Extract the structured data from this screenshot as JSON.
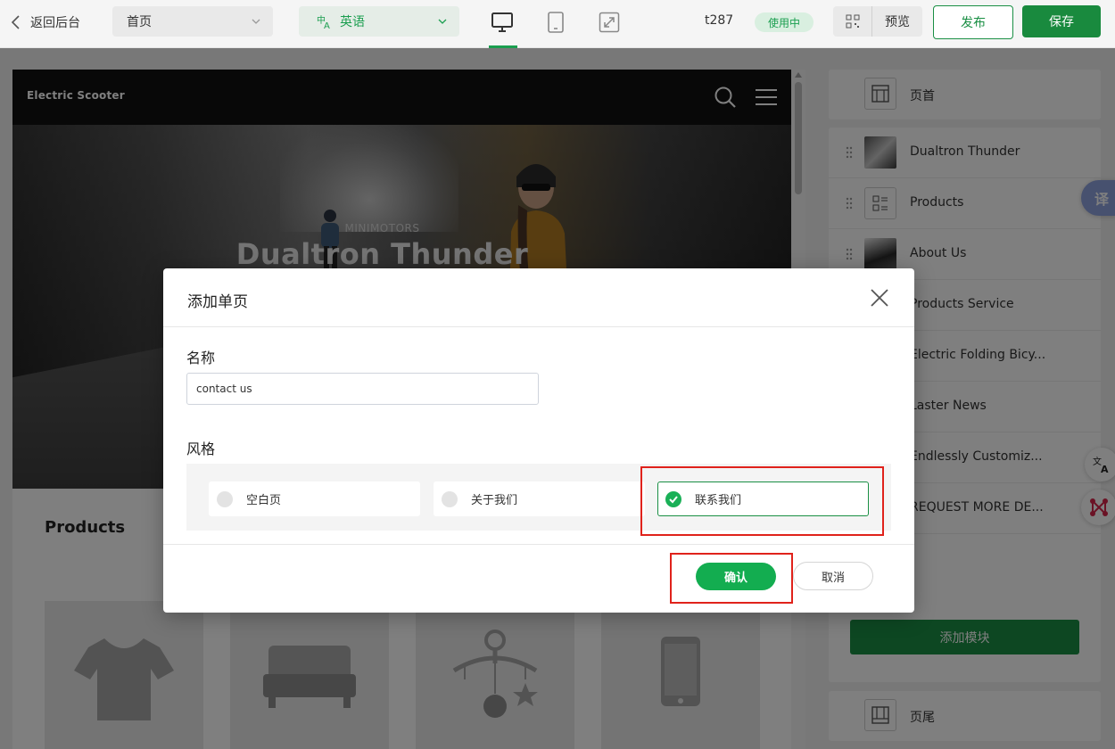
{
  "toolbar": {
    "back_label": "返回后台",
    "page_select": "首页",
    "lang_select": "英语",
    "site_id": "t287",
    "status": "使用中",
    "preview_label": "预览",
    "publish_label": "发布",
    "save_label": "保存"
  },
  "canvas": {
    "logo": "Electric Scooter",
    "hero_subtitle": "MINIMOTORS",
    "hero_title": "Dualtron Thunder",
    "products_title": "Products",
    "product_icons": [
      "tshirt-icon",
      "sofa-icon",
      "baby-mobile-icon",
      "phone-icon"
    ]
  },
  "panel": {
    "header_module": "页首",
    "modules": [
      {
        "label": "Dualtron Thunder",
        "icon": "photo-thumb"
      },
      {
        "label": "Products",
        "icon": "list-icon"
      },
      {
        "label": "About Us",
        "icon": "photo-thumb"
      },
      {
        "label": "Products Service",
        "icon": "photo-thumb"
      },
      {
        "label": "Electric Folding Bicy...",
        "icon": "photo-thumb"
      },
      {
        "label": "Laster News",
        "icon": "photo-thumb"
      },
      {
        "label": "Endlessly Customiz...",
        "icon": "photo-thumb"
      },
      {
        "label": "REQUEST MORE DE...",
        "icon": "photo-thumb"
      }
    ],
    "add_module_label": "添加模块",
    "footer_module": "页尾",
    "translate_badge": "译"
  },
  "dialog": {
    "title": "添加单页",
    "name_label": "名称",
    "name_value": "contact us",
    "style_label": "风格",
    "style_options": [
      {
        "label": "空白页",
        "selected": false
      },
      {
        "label": "关于我们",
        "selected": false
      },
      {
        "label": "联系我们",
        "selected": true
      }
    ],
    "confirm_label": "确认",
    "cancel_label": "取消"
  },
  "colors": {
    "accent": "#1a8f44",
    "highlight": "#e0221b",
    "confirm": "#13ad50"
  }
}
